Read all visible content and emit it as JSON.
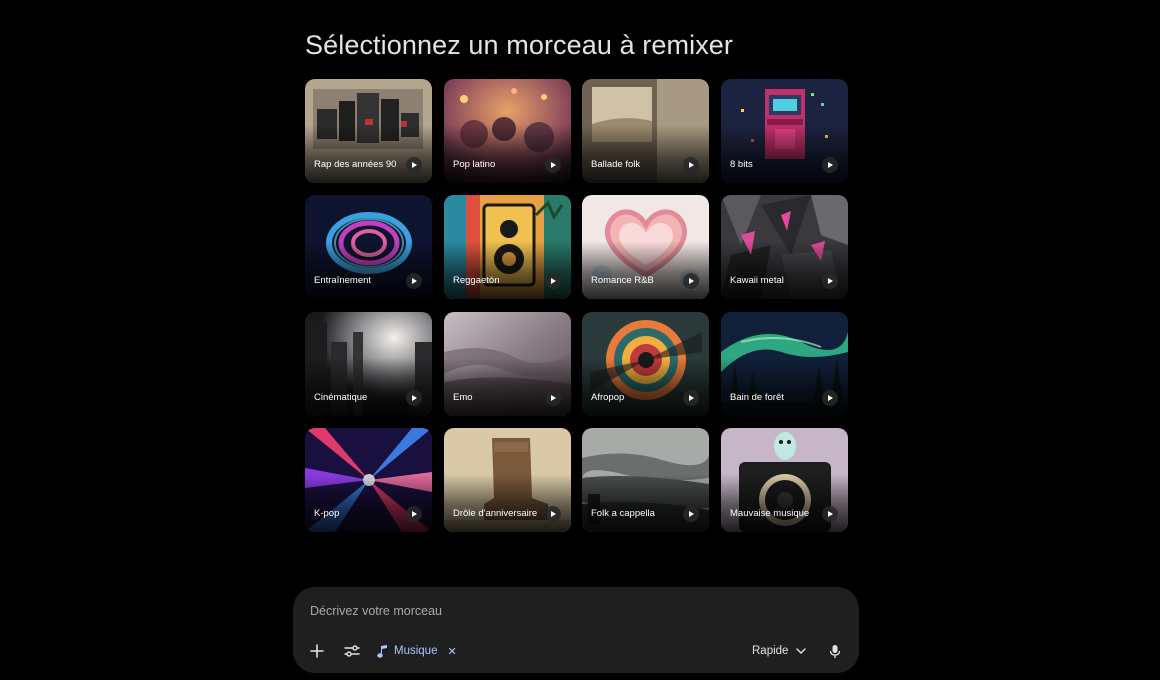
{
  "page_title": "Sélectionnez un morceau à remixer",
  "tracks": [
    {
      "label": "Rap des années 90"
    },
    {
      "label": "Pop latino"
    },
    {
      "label": "Ballade folk"
    },
    {
      "label": "8 bits"
    },
    {
      "label": "Entraînement"
    },
    {
      "label": "Reggaetón"
    },
    {
      "label": "Romance R&B"
    },
    {
      "label": "Kawaii metal"
    },
    {
      "label": "Cinématique"
    },
    {
      "label": "Emo"
    },
    {
      "label": "Afropop"
    },
    {
      "label": "Bain de forêt"
    },
    {
      "label": "K-pop"
    },
    {
      "label": "Drôle d'anniversaire"
    },
    {
      "label": "Folk a cappella"
    },
    {
      "label": "Mauvaise musique"
    }
  ],
  "composer": {
    "placeholder": "Décrivez votre morceau",
    "add_icon": "plus-icon",
    "tools_icon": "sliders-icon",
    "chip_label": "Musique",
    "chip_icon": "music-note-icon",
    "mode_label": "Rapide",
    "mic_icon": "microphone-icon"
  },
  "colors": {
    "background": "#000000",
    "composer_bg": "#1f1f1f",
    "accent": "#a8c7fa"
  }
}
